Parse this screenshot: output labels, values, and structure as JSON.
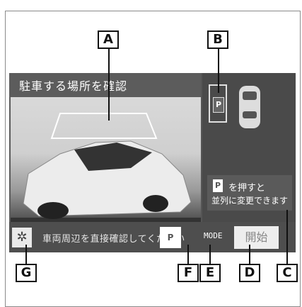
{
  "screen": {
    "title": "駐車する場所を確認",
    "bottom_message": "車両周辺を直接確認してください",
    "mode_label": "MODE",
    "start_label": "開始",
    "p_button": "P",
    "info": {
      "p_icon": "P",
      "line1": "を押すと",
      "line2": "並列に変更できます"
    },
    "parking_icon": "P",
    "settings_icon": "gear-icon"
  },
  "callouts": {
    "A": "A",
    "B": "B",
    "C": "C",
    "D": "D",
    "E": "E",
    "F": "F",
    "G": "G"
  }
}
